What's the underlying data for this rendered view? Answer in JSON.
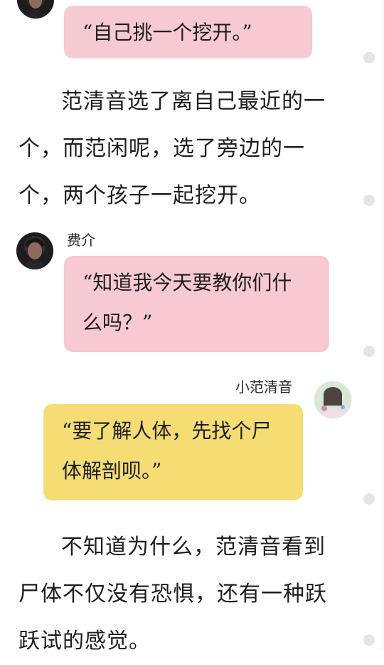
{
  "messages": [
    {
      "kind": "bubble",
      "speaker": "",
      "text": "“自己挑一个挖开。”",
      "color": "pink"
    },
    {
      "kind": "paragraph",
      "text": "范清音选了离自己最近的一个，而范闲呢，选了旁边的一个，两个孩子一起挖开。"
    },
    {
      "kind": "bubble",
      "speaker": "费介",
      "text": "“知道我今天要教你们什么吗？”",
      "color": "pink"
    },
    {
      "kind": "bubble",
      "speaker": "小范清音",
      "text": "“要了解人体，先找个尸体解剖呗。”",
      "color": "yellow"
    },
    {
      "kind": "paragraph",
      "text": "不知道为什么，范清音看到尸体不仅没有恐惧，还有一种跃跃试的感觉。"
    }
  ],
  "colors": {
    "pink_bubble": "#f7c9d3",
    "yellow_bubble": "#f5dc73",
    "dot": "#e5e5e5"
  }
}
